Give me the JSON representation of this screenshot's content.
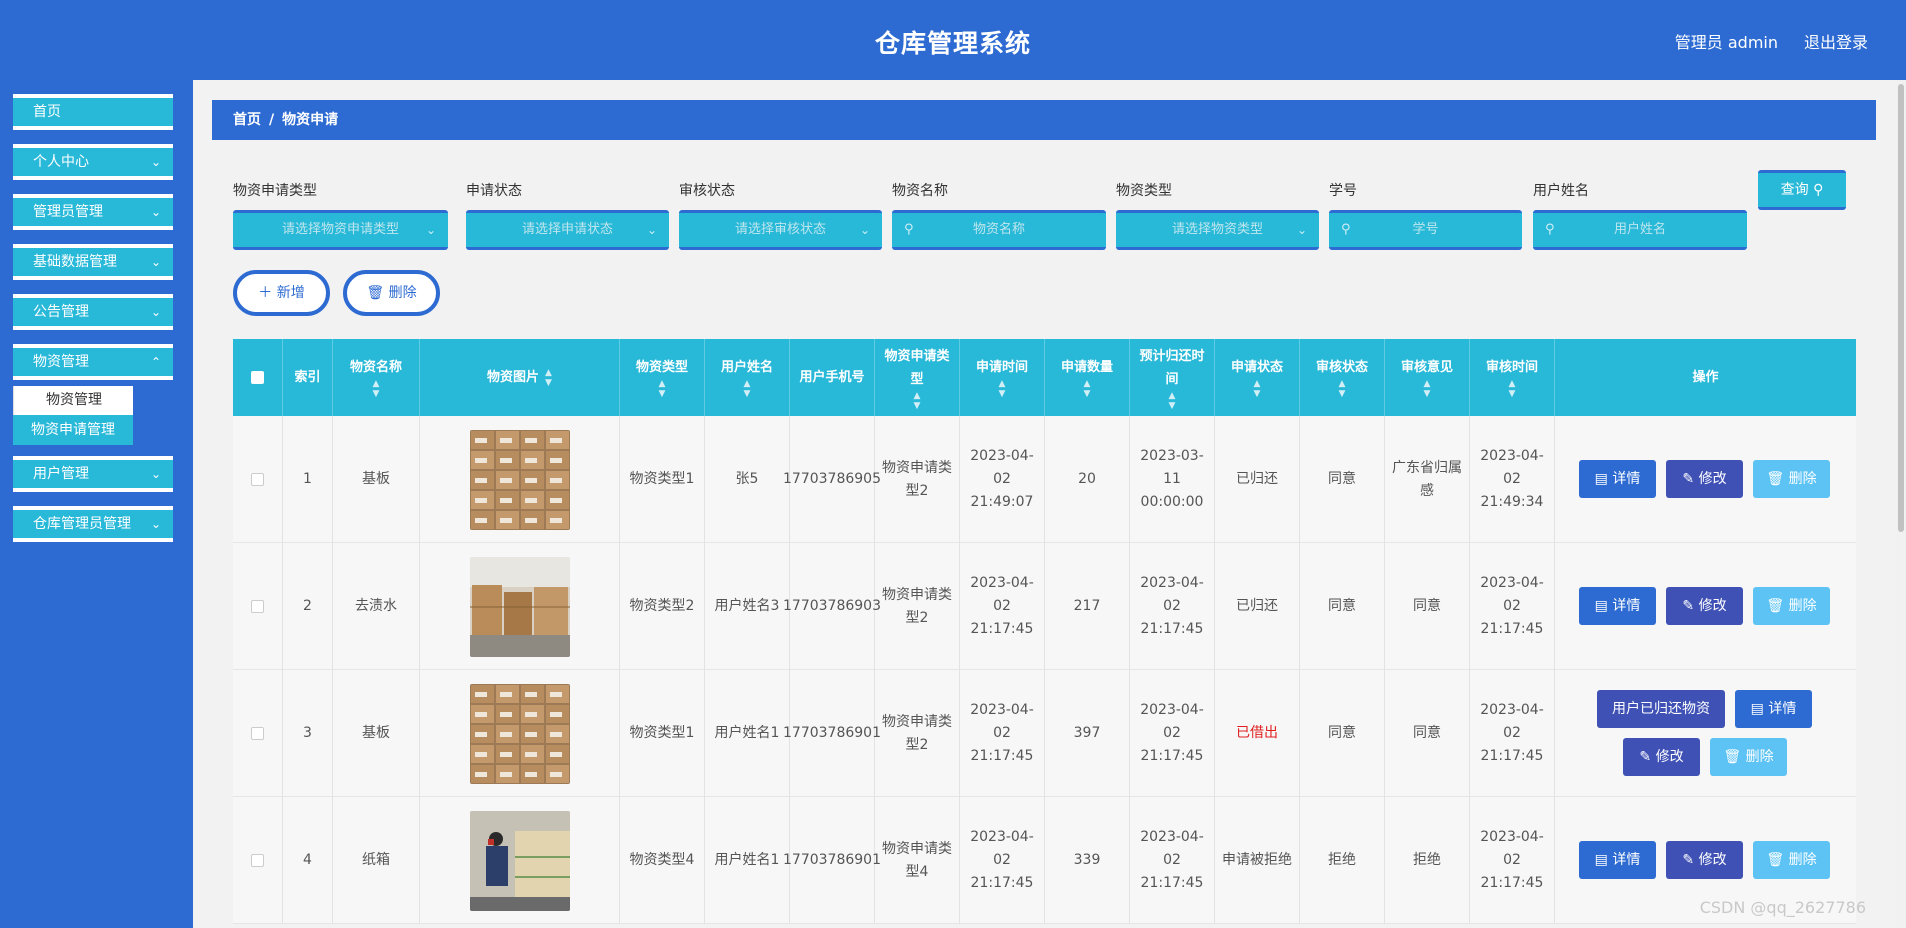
{
  "header": {
    "title": "仓库管理系统",
    "user": "管理员 admin",
    "logout": "退出登录"
  },
  "sidebar": {
    "items": [
      {
        "label": "首页",
        "has_chevron": false
      },
      {
        "label": "个人中心",
        "has_chevron": true
      },
      {
        "label": "管理员管理",
        "has_chevron": true
      },
      {
        "label": "基础数据管理",
        "has_chevron": true
      },
      {
        "label": "公告管理",
        "has_chevron": true
      },
      {
        "label": "物资管理",
        "has_chevron": true
      },
      {
        "label": "用户管理",
        "has_chevron": true
      },
      {
        "label": "仓库管理员管理",
        "has_chevron": true
      }
    ],
    "submenu": [
      "物资管理",
      "物资申请管理"
    ]
  },
  "breadcrumb": {
    "home": "首页",
    "sep": "/",
    "current": "物资申请"
  },
  "filters": [
    {
      "label": "物资申请类型",
      "placeholder": "请选择物资申请类型",
      "kind": "select"
    },
    {
      "label": "申请状态",
      "placeholder": "请选择申请状态",
      "kind": "select"
    },
    {
      "label": "审核状态",
      "placeholder": "请选择审核状态",
      "kind": "select"
    },
    {
      "label": "物资名称",
      "placeholder": "物资名称",
      "kind": "search"
    },
    {
      "label": "物资类型",
      "placeholder": "请选择物资类型",
      "kind": "select"
    },
    {
      "label": "学号",
      "placeholder": "学号",
      "kind": "search"
    },
    {
      "label": "用户姓名",
      "placeholder": "用户姓名",
      "kind": "search"
    }
  ],
  "query_button": "查询",
  "actions": {
    "add": "新增",
    "delete": "删除"
  },
  "table": {
    "columns": [
      "索引",
      "物资名称",
      "物资图片",
      "物资类型",
      "用户姓名",
      "用户手机号",
      "物资申请类型",
      "申请时间",
      "申请数量",
      "预计归还时间",
      "申请状态",
      "审核状态",
      "审核意见",
      "审核时间",
      "操作"
    ],
    "rows": [
      {
        "index": "1",
        "name": "基板",
        "photo": "boxes",
        "type": "物资类型1",
        "user": "张5",
        "phone": "17703786905",
        "apply_type": "物资申请类型2",
        "apply_time": "2023-04-02 21:49:07",
        "qty": "20",
        "return_time": "2023-03-11 00:00:00",
        "apply_status": "已归还",
        "audit_status": "同意",
        "audit_opinion": "广东省归属感",
        "audit_time": "2023-04-02 21:49:34",
        "returned_button": false
      },
      {
        "index": "2",
        "name": "去渍水",
        "photo": "warehouse",
        "type": "物资类型2",
        "user": "用户姓名3",
        "phone": "17703786903",
        "apply_type": "物资申请类型2",
        "apply_time": "2023-04-02 21:17:45",
        "qty": "217",
        "return_time": "2023-04-02 21:17:45",
        "apply_status": "已归还",
        "audit_status": "同意",
        "audit_opinion": "同意",
        "audit_time": "2023-04-02 21:17:45",
        "returned_button": false
      },
      {
        "index": "3",
        "name": "基板",
        "photo": "boxes",
        "type": "物资类型1",
        "user": "用户姓名1",
        "phone": "17703786901",
        "apply_type": "物资申请类型2",
        "apply_time": "2023-04-02 21:17:45",
        "qty": "397",
        "return_time": "2023-04-02 21:17:45",
        "apply_status": "已借出",
        "audit_status": "同意",
        "audit_opinion": "同意",
        "audit_time": "2023-04-02 21:17:45",
        "returned_button": true
      },
      {
        "index": "4",
        "name": "纸箱",
        "photo": "worker",
        "type": "物资类型4",
        "user": "用户姓名1",
        "phone": "17703786901",
        "apply_type": "物资申请类型4",
        "apply_time": "2023-04-02 21:17:45",
        "qty": "339",
        "return_time": "2023-04-02 21:17:45",
        "apply_status": "申请被拒绝",
        "audit_status": "拒绝",
        "audit_opinion": "拒绝",
        "audit_time": "2023-04-02 21:17:45",
        "returned_button": false
      }
    ],
    "op_labels": {
      "detail": "详情",
      "edit": "修改",
      "delete": "删除",
      "returned": "用户已归还物资"
    }
  },
  "colors": {
    "primary": "#2d6bd2",
    "accent": "#28b8d8",
    "edit": "#3f51b5",
    "delete": "#5cc3f4",
    "danger": "#e02020"
  },
  "watermark": "CSDN @qq_2627786"
}
